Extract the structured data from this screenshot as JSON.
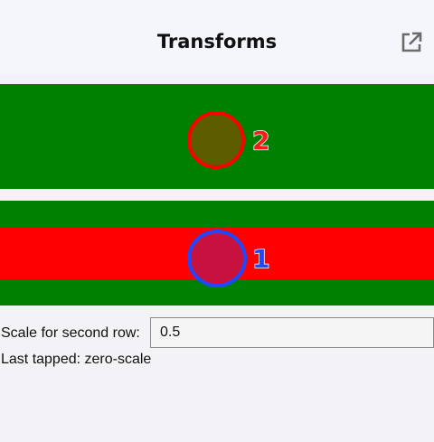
{
  "header": {
    "title": "Transforms",
    "action_icon": "open-in-new-icon"
  },
  "rows": [
    {
      "label": "2",
      "ring_color": "#ff0000",
      "fill_color": "#5c5c00"
    },
    {
      "label": "1",
      "ring_color": "#1f48ff",
      "fill_color": "#c71240"
    }
  ],
  "colors": {
    "row_background": "#008000",
    "band": "#ff0000"
  },
  "form": {
    "scale_label": "Scale for second row:",
    "scale_value": "0.5"
  },
  "status": {
    "last_tapped": "Last tapped: zero-scale"
  }
}
